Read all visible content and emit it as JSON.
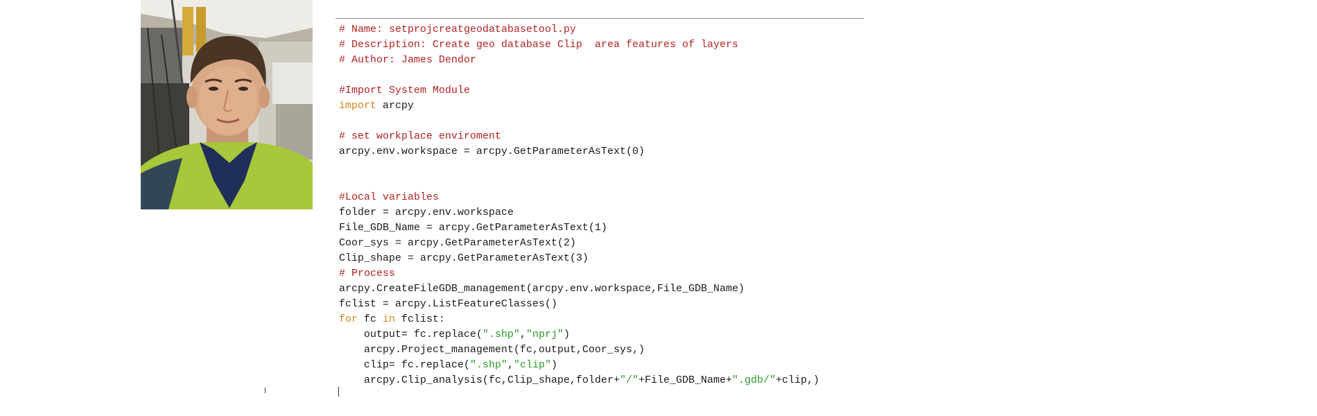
{
  "photo": {
    "alt": ""
  },
  "colors": {
    "comment": "#b22222",
    "keyword": "#d2861e",
    "string": "#2e9a2e",
    "text": "#1a1a1a"
  },
  "code": {
    "lines": [
      {
        "parts": [
          {
            "t": "# Name: setprojcreatgeodatabasetool.py",
            "c": "cm"
          }
        ]
      },
      {
        "parts": [
          {
            "t": "# Description: Create geo database Clip  area features of layers",
            "c": "cm"
          }
        ]
      },
      {
        "parts": [
          {
            "t": "# Author: James Dendor",
            "c": "cm"
          }
        ]
      },
      {
        "parts": []
      },
      {
        "parts": [
          {
            "t": "#Import System Module",
            "c": "cm"
          }
        ]
      },
      {
        "parts": [
          {
            "t": "import",
            "c": "kw"
          },
          {
            "t": " arcpy",
            "c": "txt"
          }
        ]
      },
      {
        "parts": []
      },
      {
        "parts": [
          {
            "t": "# set workplace enviroment",
            "c": "cm"
          }
        ]
      },
      {
        "parts": [
          {
            "t": "arcpy.env.workspace = arcpy.GetParameterAsText(0)",
            "c": "txt"
          }
        ]
      },
      {
        "parts": []
      },
      {
        "parts": []
      },
      {
        "parts": [
          {
            "t": "#Local variables",
            "c": "cm"
          }
        ]
      },
      {
        "parts": [
          {
            "t": "folder = arcpy.env.workspace",
            "c": "txt"
          }
        ]
      },
      {
        "parts": [
          {
            "t": "File_GDB_Name = arcpy.GetParameterAsText(1)",
            "c": "txt"
          }
        ]
      },
      {
        "parts": [
          {
            "t": "Coor_sys = arcpy.GetParameterAsText(2)",
            "c": "txt"
          }
        ]
      },
      {
        "parts": [
          {
            "t": "Clip_shape = arcpy.GetParameterAsText(3)",
            "c": "txt"
          }
        ]
      },
      {
        "parts": [
          {
            "t": "# Process",
            "c": "cm"
          }
        ]
      },
      {
        "parts": [
          {
            "t": "arcpy.CreateFileGDB_management(arcpy.env.workspace,File_GDB_Name)",
            "c": "txt"
          }
        ]
      },
      {
        "parts": [
          {
            "t": "fclist = arcpy.ListFeatureClasses()",
            "c": "txt"
          }
        ]
      },
      {
        "parts": [
          {
            "t": "for",
            "c": "kw"
          },
          {
            "t": " fc ",
            "c": "txt"
          },
          {
            "t": "in",
            "c": "kw"
          },
          {
            "t": " fclist:",
            "c": "txt"
          }
        ]
      },
      {
        "parts": [
          {
            "t": "    output= fc.replace(",
            "c": "txt"
          },
          {
            "t": "\".shp\"",
            "c": "str"
          },
          {
            "t": ",",
            "c": "txt"
          },
          {
            "t": "\"nprj\"",
            "c": "str"
          },
          {
            "t": ")",
            "c": "txt"
          }
        ]
      },
      {
        "parts": [
          {
            "t": "    arcpy.Project_management(fc,output,Coor_sys,)",
            "c": "txt"
          }
        ]
      },
      {
        "parts": [
          {
            "t": "    clip= fc.replace(",
            "c": "txt"
          },
          {
            "t": "\".shp\"",
            "c": "str"
          },
          {
            "t": ",",
            "c": "txt"
          },
          {
            "t": "\"clip\"",
            "c": "str"
          },
          {
            "t": ")",
            "c": "txt"
          }
        ]
      },
      {
        "parts": [
          {
            "t": "    arcpy.Clip_analysis(fc,Clip_shape,folder+",
            "c": "txt"
          },
          {
            "t": "\"/\"",
            "c": "str"
          },
          {
            "t": "+File_GDB_Name+",
            "c": "txt"
          },
          {
            "t": "\".gdb/\"",
            "c": "str"
          },
          {
            "t": "+clip,)",
            "c": "txt"
          }
        ]
      }
    ]
  }
}
